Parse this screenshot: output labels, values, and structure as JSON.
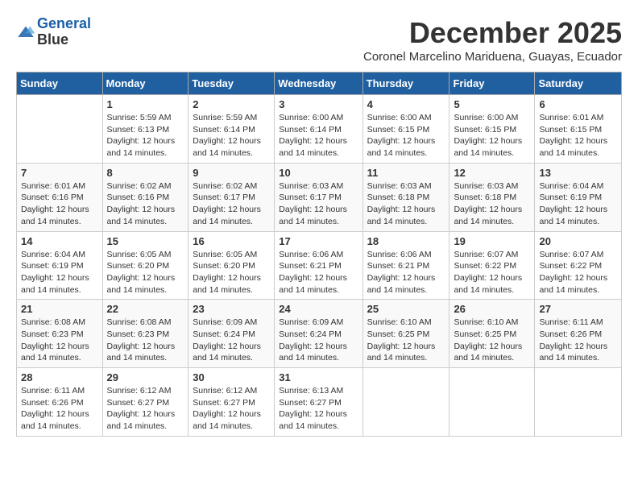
{
  "logo": {
    "line1": "General",
    "line2": "Blue"
  },
  "title": "December 2025",
  "subtitle": "Coronel Marcelino Mariduena, Guayas, Ecuador",
  "days_header": [
    "Sunday",
    "Monday",
    "Tuesday",
    "Wednesday",
    "Thursday",
    "Friday",
    "Saturday"
  ],
  "weeks": [
    [
      {
        "day": "",
        "info": ""
      },
      {
        "day": "1",
        "info": "Sunrise: 5:59 AM\nSunset: 6:13 PM\nDaylight: 12 hours\nand 14 minutes."
      },
      {
        "day": "2",
        "info": "Sunrise: 5:59 AM\nSunset: 6:14 PM\nDaylight: 12 hours\nand 14 minutes."
      },
      {
        "day": "3",
        "info": "Sunrise: 6:00 AM\nSunset: 6:14 PM\nDaylight: 12 hours\nand 14 minutes."
      },
      {
        "day": "4",
        "info": "Sunrise: 6:00 AM\nSunset: 6:15 PM\nDaylight: 12 hours\nand 14 minutes."
      },
      {
        "day": "5",
        "info": "Sunrise: 6:00 AM\nSunset: 6:15 PM\nDaylight: 12 hours\nand 14 minutes."
      },
      {
        "day": "6",
        "info": "Sunrise: 6:01 AM\nSunset: 6:15 PM\nDaylight: 12 hours\nand 14 minutes."
      }
    ],
    [
      {
        "day": "7",
        "info": ""
      },
      {
        "day": "8",
        "info": "Sunrise: 6:02 AM\nSunset: 6:16 PM\nDaylight: 12 hours\nand 14 minutes."
      },
      {
        "day": "9",
        "info": "Sunrise: 6:02 AM\nSunset: 6:17 PM\nDaylight: 12 hours\nand 14 minutes."
      },
      {
        "day": "10",
        "info": "Sunrise: 6:03 AM\nSunset: 6:17 PM\nDaylight: 12 hours\nand 14 minutes."
      },
      {
        "day": "11",
        "info": "Sunrise: 6:03 AM\nSunset: 6:18 PM\nDaylight: 12 hours\nand 14 minutes."
      },
      {
        "day": "12",
        "info": "Sunrise: 6:03 AM\nSunset: 6:18 PM\nDaylight: 12 hours\nand 14 minutes."
      },
      {
        "day": "13",
        "info": "Sunrise: 6:04 AM\nSunset: 6:19 PM\nDaylight: 12 hours\nand 14 minutes."
      }
    ],
    [
      {
        "day": "14",
        "info": ""
      },
      {
        "day": "15",
        "info": "Sunrise: 6:05 AM\nSunset: 6:20 PM\nDaylight: 12 hours\nand 14 minutes."
      },
      {
        "day": "16",
        "info": "Sunrise: 6:05 AM\nSunset: 6:20 PM\nDaylight: 12 hours\nand 14 minutes."
      },
      {
        "day": "17",
        "info": "Sunrise: 6:06 AM\nSunset: 6:21 PM\nDaylight: 12 hours\nand 14 minutes."
      },
      {
        "day": "18",
        "info": "Sunrise: 6:06 AM\nSunset: 6:21 PM\nDaylight: 12 hours\nand 14 minutes."
      },
      {
        "day": "19",
        "info": "Sunrise: 6:07 AM\nSunset: 6:22 PM\nDaylight: 12 hours\nand 14 minutes."
      },
      {
        "day": "20",
        "info": "Sunrise: 6:07 AM\nSunset: 6:22 PM\nDaylight: 12 hours\nand 14 minutes."
      }
    ],
    [
      {
        "day": "21",
        "info": ""
      },
      {
        "day": "22",
        "info": "Sunrise: 6:08 AM\nSunset: 6:23 PM\nDaylight: 12 hours\nand 14 minutes."
      },
      {
        "day": "23",
        "info": "Sunrise: 6:09 AM\nSunset: 6:24 PM\nDaylight: 12 hours\nand 14 minutes."
      },
      {
        "day": "24",
        "info": "Sunrise: 6:09 AM\nSunset: 6:24 PM\nDaylight: 12 hours\nand 14 minutes."
      },
      {
        "day": "25",
        "info": "Sunrise: 6:10 AM\nSunset: 6:25 PM\nDaylight: 12 hours\nand 14 minutes."
      },
      {
        "day": "26",
        "info": "Sunrise: 6:10 AM\nSunset: 6:25 PM\nDaylight: 12 hours\nand 14 minutes."
      },
      {
        "day": "27",
        "info": "Sunrise: 6:11 AM\nSunset: 6:26 PM\nDaylight: 12 hours\nand 14 minutes."
      }
    ],
    [
      {
        "day": "28",
        "info": "Sunrise: 6:11 AM\nSunset: 6:26 PM\nDaylight: 12 hours\nand 14 minutes."
      },
      {
        "day": "29",
        "info": "Sunrise: 6:12 AM\nSunset: 6:27 PM\nDaylight: 12 hours\nand 14 minutes."
      },
      {
        "day": "30",
        "info": "Sunrise: 6:12 AM\nSunset: 6:27 PM\nDaylight: 12 hours\nand 14 minutes."
      },
      {
        "day": "31",
        "info": "Sunrise: 6:13 AM\nSunset: 6:27 PM\nDaylight: 12 hours\nand 14 minutes."
      },
      {
        "day": "",
        "info": ""
      },
      {
        "day": "",
        "info": ""
      },
      {
        "day": "",
        "info": ""
      }
    ]
  ],
  "week1_sunday_info": "Sunrise: 6:01 AM\nSunset: 6:16 PM\nDaylight: 12 hours\nand 14 minutes.",
  "week2_sunday_info": "Sunrise: 6:04 AM\nSunset: 6:19 PM\nDaylight: 12 hours\nand 14 minutes.",
  "week3_sunday_info": "Sunrise: 6:08 AM\nSunset: 6:23 PM\nDaylight: 12 hours\nand 14 minutes."
}
